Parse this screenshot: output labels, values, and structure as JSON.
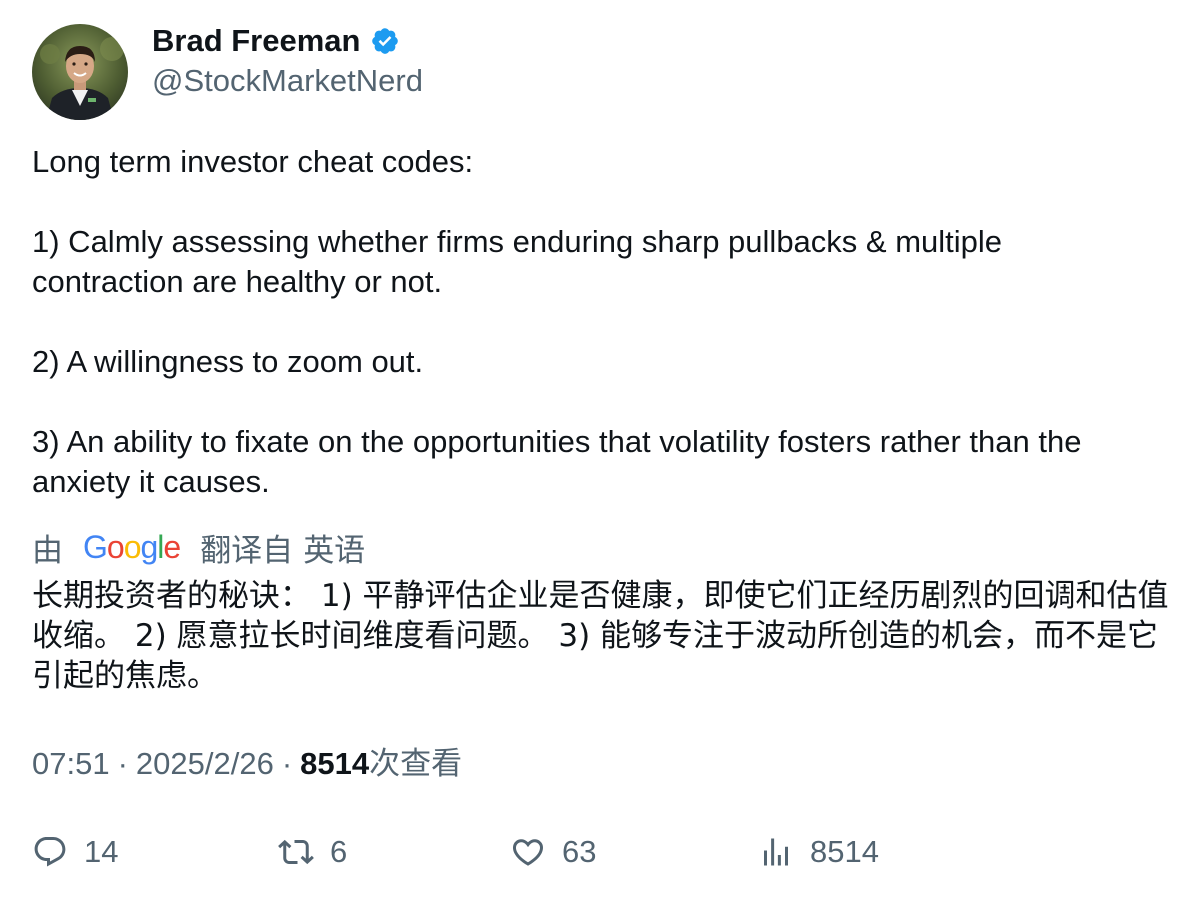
{
  "author": {
    "name": "Brad Freeman",
    "handle": "@StockMarketNerd",
    "avatar_icon": "profile-photo",
    "verified_color": "#1d9bf0"
  },
  "tweet": {
    "paragraphs": [
      "Long term investor cheat codes:",
      "1) Calmly assessing whether firms enduring sharp pullbacks & multiple contraction are healthy or not.",
      "2) A willingness to zoom out.",
      "3) An ability to fixate on the opportunities that volatility fosters rather than the anxiety it causes."
    ]
  },
  "translation": {
    "prefix": "由",
    "provider": "Google",
    "suffix": "翻译自",
    "language": "英语",
    "text": "长期投资者的秘诀： 1) 平静评估企业是否健康，即使它们正经历剧烈的回调和估值收缩。 2) 愿意拉长时间维度看问题。 3) 能够专注于波动所创造的机会，而不是它引起的焦虑。"
  },
  "meta": {
    "time": "07:51",
    "separator": "·",
    "date": "2025/2/26",
    "views_count": "8514",
    "views_label": "次查看"
  },
  "actions": {
    "replies": "14",
    "reposts": "6",
    "likes": "63",
    "views": "8514"
  },
  "colors": {
    "text": "#0f1419",
    "secondary": "#536471",
    "accent": "#1d9bf0"
  }
}
